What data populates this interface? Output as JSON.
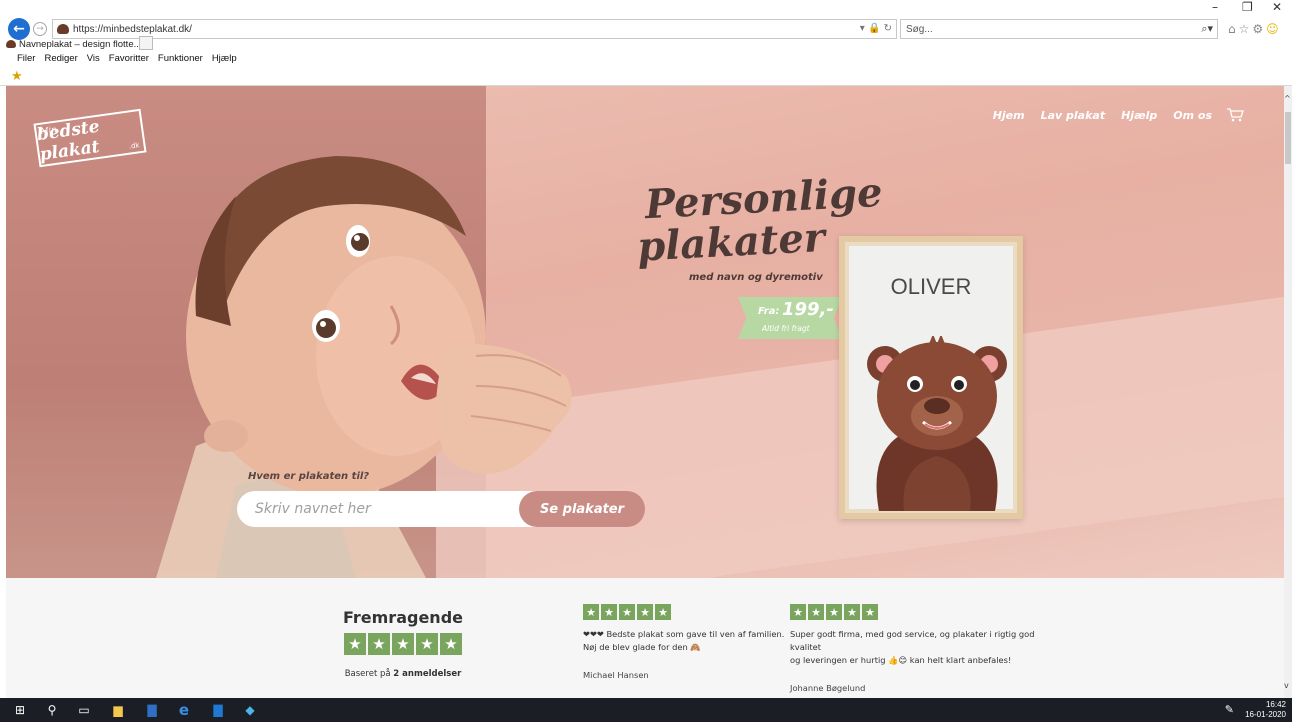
{
  "browser": {
    "url": "https://minbedsteplakat.dk/",
    "search_placeholder": "Søg...",
    "tab_title": "Navneplakat – design flotte...",
    "menu": [
      "Filer",
      "Rediger",
      "Vis",
      "Favoritter",
      "Funktioner",
      "Hjælp"
    ]
  },
  "site": {
    "logo": {
      "small": "Min",
      "main": "bedste plakat",
      "tld": ".dk"
    },
    "nav": [
      "Hjem",
      "Lav plakat",
      "Hjælp",
      "Om os"
    ],
    "headline_1": "Personlige",
    "headline_2": "plakater",
    "subline": "med navn og dyremotiv",
    "price": {
      "prefix": "Fra:",
      "value": "199,-",
      "note": "Altid fri fragt"
    },
    "poster_name": "OLIVER",
    "form": {
      "label": "Hvem er plakaten til?",
      "placeholder": "Skriv navnet her",
      "button": "Se plakater"
    }
  },
  "reviews": {
    "summary_title": "Fremragende",
    "summary_stars": 5,
    "summary_note_prefix": "Baseret på",
    "summary_note_bold": "2 anmeldelser",
    "items": [
      {
        "stars": 5,
        "text_1": "❤❤❤ Bedste plakat som gave til ven af familien.",
        "text_2": "Nøj de blev glade for den 🙈",
        "author": "Michael Hansen"
      },
      {
        "stars": 5,
        "text_1": "Super godt firma, med god service, og plakater i rigtig god kvalitet",
        "text_2": "og leveringen er hurtig 👍😊 kan helt klart anbefales!",
        "author": "Johanne Bøgelund"
      }
    ]
  },
  "taskbar": {
    "time": "16:42",
    "date": "16-01-2020"
  },
  "colors": {
    "accent": "#c98c84",
    "star_green": "#7aa55e",
    "ribbon_green": "#b7d8a3",
    "ie_blue": "#1f6fd0"
  }
}
